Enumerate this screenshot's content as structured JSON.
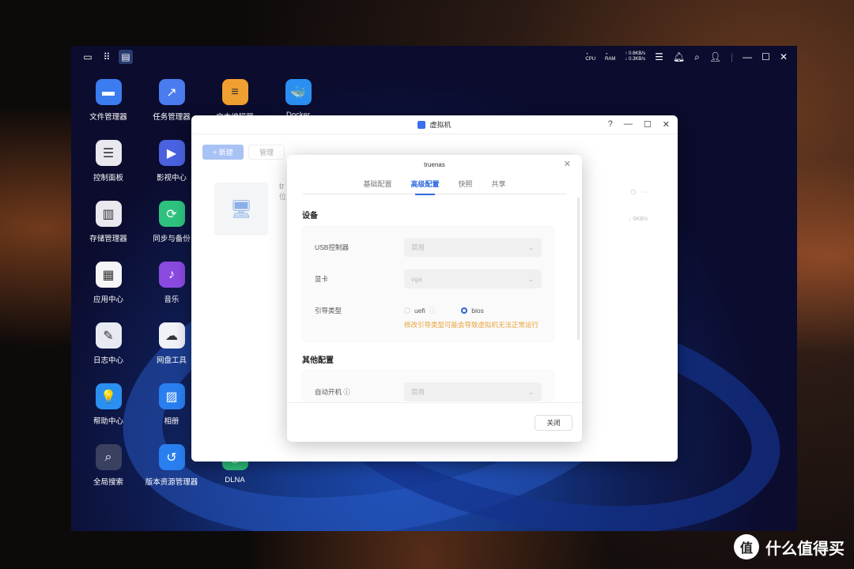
{
  "topbar": {
    "net_up": "0.6KB/s",
    "net_down": "0.3KB/s",
    "cpu": "CPU",
    "ram": "RAM"
  },
  "desktop": [
    {
      "label": "文件管理器",
      "color": "#3b7cf0",
      "glyph": "▬"
    },
    {
      "label": "任务管理器",
      "color": "#4a7cf0",
      "glyph": "↗"
    },
    {
      "label": "文本编辑器",
      "color": "#f0a030",
      "glyph": "≡"
    },
    {
      "label": "Docker",
      "color": "#2a8ff0",
      "glyph": "🐳"
    },
    {
      "label": "控制面板",
      "color": "#e8e8ee",
      "glyph": "☰"
    },
    {
      "label": "影视中心",
      "color": "#4a62e0",
      "glyph": "▶"
    },
    {
      "label": "存储管理器",
      "color": "#e8e8ee",
      "glyph": "▥"
    },
    {
      "label": "同步与备份",
      "color": "#2ec27e",
      "glyph": "⟳"
    },
    {
      "label": "应用中心",
      "color": "#f5f5f8",
      "glyph": "▦"
    },
    {
      "label": "音乐",
      "color": "#8a4ae0",
      "glyph": "♪"
    },
    {
      "label": "日志中心",
      "color": "#e8eaf2",
      "glyph": "✎"
    },
    {
      "label": "网盘工具",
      "color": "#f0f2f8",
      "glyph": "☁"
    },
    {
      "label": "帮助中心",
      "color": "#2a8ff0",
      "glyph": "💡"
    },
    {
      "label": "相册",
      "color": "#2a7ff0",
      "glyph": "▨"
    },
    {
      "label": "全局搜索",
      "color": "#3a4060",
      "glyph": "⌕"
    },
    {
      "label": "版本资源管理器",
      "color": "#2a7ff0",
      "glyph": "↺"
    },
    {
      "label": "DLNA",
      "color": "#2ec27e",
      "glyph": "◉"
    }
  ],
  "vm_window": {
    "title": "虚拟机",
    "help": "?",
    "new_button": "+ 新建",
    "manage_button": "管理",
    "vm_name": "tr",
    "vm_sub": "位",
    "speed": "↓ 0KB/s"
  },
  "dialog": {
    "title": "truenas",
    "tabs": [
      "基础配置",
      "高级配置",
      "快照",
      "共享"
    ],
    "active_tab": 1,
    "section_device": "设备",
    "usb_label": "USB控制器",
    "usb_value": "禁用",
    "gpu_label": "显卡",
    "gpu_value": "vga",
    "boot_label": "引导类型",
    "boot_uefi": "uefi",
    "boot_bios": "bios",
    "boot_selected": "bios",
    "boot_warning": "修改引导类型可能会导致虚拟机无法正常运行",
    "section_other": "其他配置",
    "autostart_label": "自动开机",
    "autostart_value": "禁用",
    "close_button": "关闭"
  },
  "watermark": {
    "logo": "值",
    "text": "什么值得买"
  }
}
